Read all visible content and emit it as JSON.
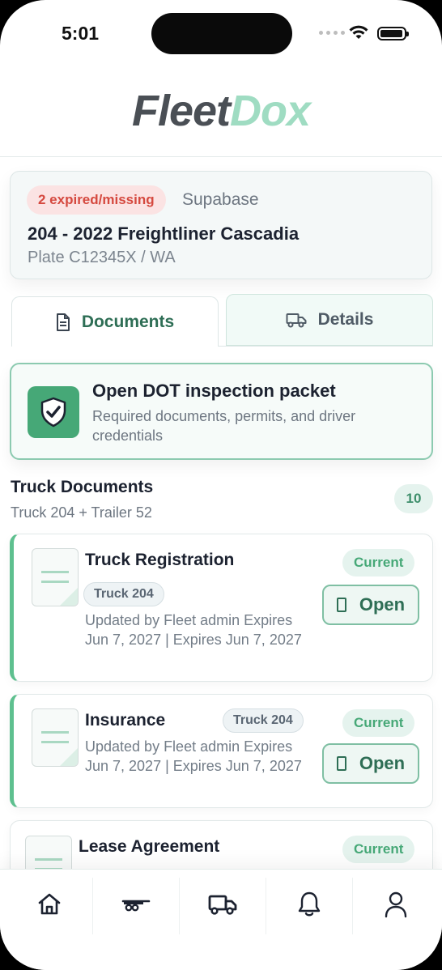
{
  "status_bar": {
    "time": "5:01"
  },
  "app": {
    "logo_part1": "Fleet",
    "logo_part2": "Dox",
    "accent": "#46a877"
  },
  "vehicle": {
    "badge": "2 expired/missing",
    "source": "Supabase",
    "title": "204 - 2022 Freightliner Cascadia",
    "plate": "Plate C12345X / WA"
  },
  "tabs": [
    {
      "label": "Documents",
      "icon": "document-icon",
      "active": true
    },
    {
      "label": "Details",
      "icon": "truck-icon",
      "active": false
    }
  ],
  "dot_packet": {
    "title": "Open DOT inspection packet",
    "subtitle": "Required documents, permits, and driver credentials",
    "icon": "shield-check-icon"
  },
  "section": {
    "title": "Truck Documents",
    "subtitle": "Truck 204 + Trailer 52",
    "count": "10"
  },
  "documents": [
    {
      "title": "Truck Registration",
      "tag": "Truck 204",
      "meta": "Updated by Fleet admin Expires Jun 7, 2027 | Expires Jun 7, 2027",
      "status": "Current",
      "action": "Open"
    },
    {
      "title": "Insurance",
      "tag": "Truck 204",
      "meta": "Updated by Fleet admin Expires Jun 7, 2027 | Expires Jun 7, 2027",
      "status": "Current",
      "action": "Open"
    },
    {
      "title": "Lease Agreement",
      "status": "Current"
    }
  ],
  "bottom_nav": [
    {
      "icon": "home-icon"
    },
    {
      "icon": "trailer-icon"
    },
    {
      "icon": "truck-icon"
    },
    {
      "icon": "bell-icon"
    },
    {
      "icon": "user-icon"
    }
  ]
}
